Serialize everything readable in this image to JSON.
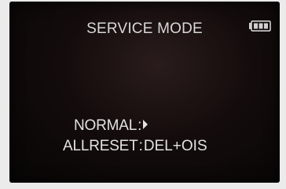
{
  "screen": {
    "title": "SERVICE MODE",
    "battery_icon": "battery-icon",
    "menu": [
      {
        "label": "NORMAL",
        "separator": ":",
        "value_icon": "play-arrow-icon"
      },
      {
        "label": "ALLRESET",
        "separator": ":",
        "value": "DEL+OIS"
      }
    ]
  }
}
